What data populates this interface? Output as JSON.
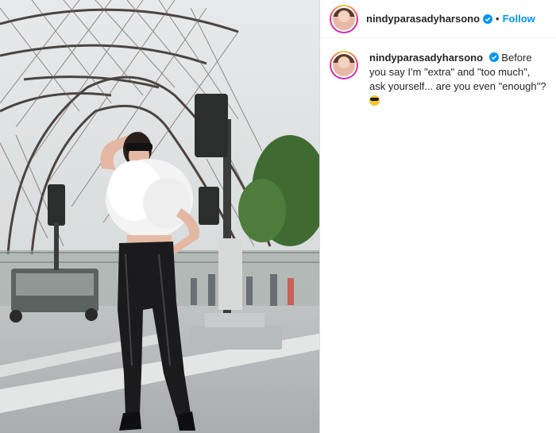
{
  "post": {
    "username": "nindyparasadyharsono",
    "follow_label": "Follow",
    "dot": "•"
  },
  "caption": {
    "username": "nindyparasadyharsono",
    "text": "Before you say I'm \"extra\" and \"too much\", ask yourself... are you even \"enough\"?"
  },
  "icons": {
    "verified": "verified-badge-icon",
    "emoji": "sunglasses-emoji-icon"
  },
  "colors": {
    "link": "#0095f6",
    "verified": "#0095f6",
    "text": "#262626"
  }
}
